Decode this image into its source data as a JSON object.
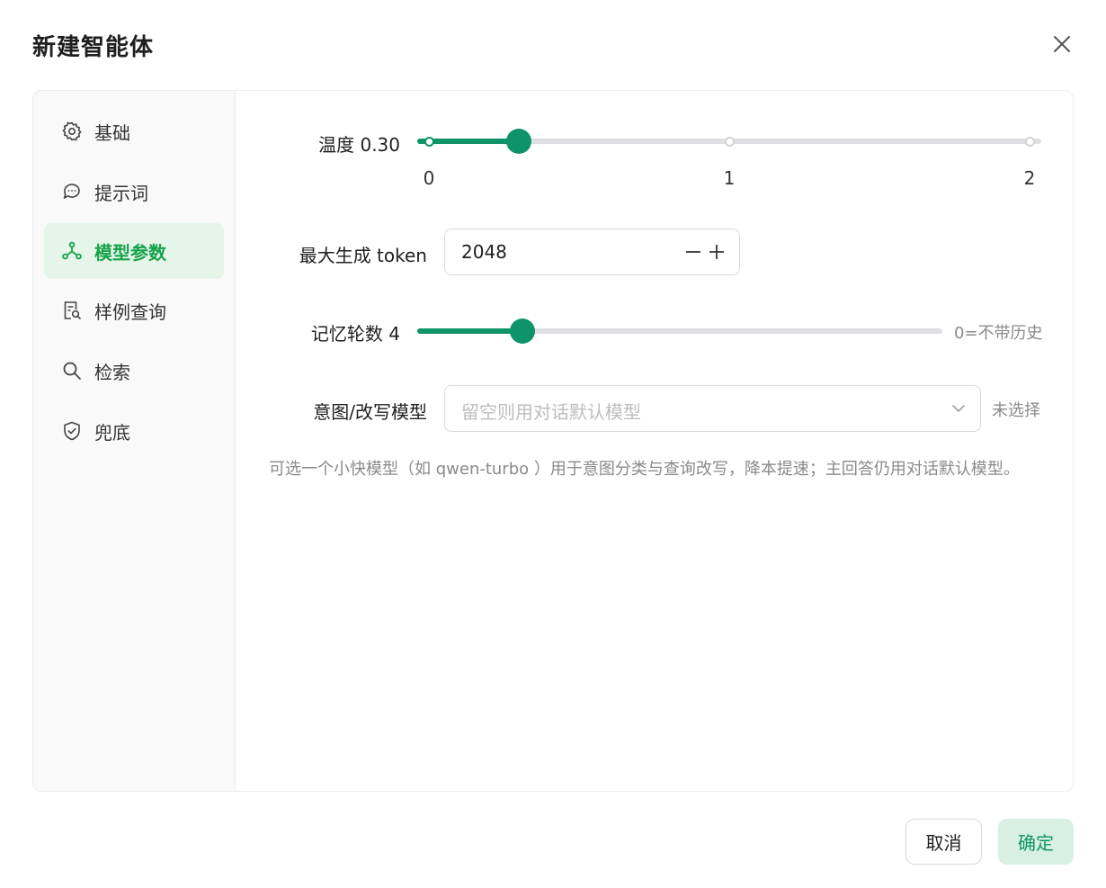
{
  "dialog": {
    "title": "新建智能体",
    "close_icon": "close-icon"
  },
  "sidebar": {
    "items": [
      {
        "label": "基础",
        "icon": "gear-icon",
        "active": false
      },
      {
        "label": "提示词",
        "icon": "chat-bubbles-icon",
        "active": false
      },
      {
        "label": "模型参数",
        "icon": "nodes-icon",
        "active": true
      },
      {
        "label": "样例查询",
        "icon": "doc-search-icon",
        "active": false
      },
      {
        "label": "检索",
        "icon": "search-icon",
        "active": false
      },
      {
        "label": "兜底",
        "icon": "shield-check-icon",
        "active": false
      }
    ]
  },
  "temperature": {
    "label": "温度 0.30",
    "value": 0.3,
    "min": 0,
    "max": 2,
    "marks": [
      "0",
      "1",
      "2"
    ]
  },
  "max_tokens": {
    "label": "最大生成 token",
    "value": "2048",
    "minus_icon": "minus-icon",
    "plus_icon": "plus-icon"
  },
  "memory": {
    "label": "记忆轮数 4",
    "value": 4,
    "max": 20,
    "hint": "0=不带历史"
  },
  "intent_model": {
    "label": "意图/改写模型",
    "placeholder": "留空则用对话默认模型",
    "status": "未选择",
    "help": "可选一个小快模型（如 qwen-turbo ）用于意图分类与查询改写，降本提速；主回答仍用对话默认模型。"
  },
  "footer": {
    "cancel_label": "取消",
    "ok_label": "确定"
  },
  "colors": {
    "accent": "#0e9468",
    "active_nav_bg": "#e6f5ea",
    "active_nav_text": "#16a34a",
    "ok_button_bg": "#d8f0e3"
  }
}
